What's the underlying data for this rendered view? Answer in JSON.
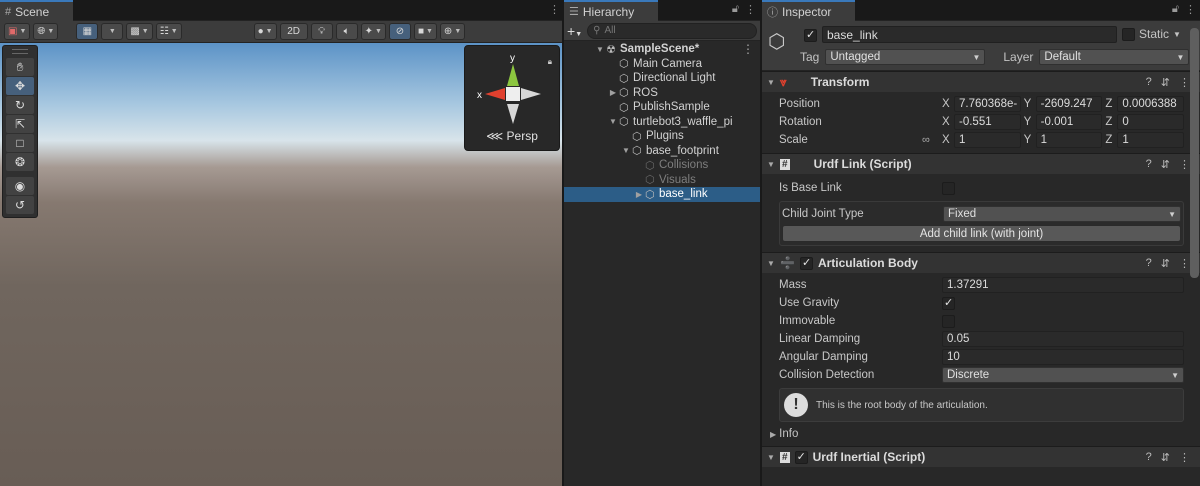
{
  "scene": {
    "tab_label": "Scene",
    "mode_2d": "2D",
    "persp_label": "Persp",
    "gizmo_y": "y",
    "gizmo_x": "x"
  },
  "hierarchy": {
    "tab_label": "Hierarchy",
    "search_placeholder": "All",
    "items": [
      {
        "label": "SampleScene*",
        "depth": 0,
        "expanded": true,
        "type": "scene"
      },
      {
        "label": "Main Camera",
        "depth": 1
      },
      {
        "label": "Directional Light",
        "depth": 1
      },
      {
        "label": "ROS",
        "depth": 1,
        "collapsed": true
      },
      {
        "label": "PublishSample",
        "depth": 1
      },
      {
        "label": "turtlebot3_waffle_pi",
        "depth": 1,
        "expanded": true
      },
      {
        "label": "Plugins",
        "depth": 2
      },
      {
        "label": "base_footprint",
        "depth": 2,
        "expanded": true
      },
      {
        "label": "Collisions",
        "depth": 3,
        "dim": true
      },
      {
        "label": "Visuals",
        "depth": 3,
        "dim": true
      },
      {
        "label": "base_link",
        "depth": 3,
        "collapsed": true,
        "selected": true
      }
    ]
  },
  "inspector": {
    "tab_label": "Inspector",
    "object_name": "base_link",
    "static_label": "Static",
    "tag_label": "Tag",
    "tag_value": "Untagged",
    "layer_label": "Layer",
    "layer_value": "Default",
    "transform": {
      "title": "Transform",
      "position_label": "Position",
      "rotation_label": "Rotation",
      "scale_label": "Scale",
      "position": {
        "x": "7.760368e-",
        "y": "-2609.247",
        "z": "0.0006388"
      },
      "rotation": {
        "x": "-0.551",
        "y": "-0.001",
        "z": "0"
      },
      "scale": {
        "x": "1",
        "y": "1",
        "z": "1"
      }
    },
    "urdf_link": {
      "title": "Urdf Link (Script)",
      "is_base_label": "Is Base Link",
      "child_joint_label": "Child Joint Type",
      "child_joint_value": "Fixed",
      "add_child_button": "Add child link (with joint)"
    },
    "articulation": {
      "title": "Articulation Body",
      "mass_label": "Mass",
      "mass": "1.37291",
      "use_gravity_label": "Use Gravity",
      "immovable_label": "Immovable",
      "linear_damping_label": "Linear Damping",
      "linear_damping": "0.05",
      "angular_damping_label": "Angular Damping",
      "angular_damping": "10",
      "collision_label": "Collision Detection",
      "collision_value": "Discrete",
      "help_text": "This is the root body of the articulation.",
      "info_label": "Info"
    },
    "urdf_inertial": {
      "title": "Urdf Inertial (Script)"
    }
  },
  "axis_labels": {
    "x": "X",
    "y": "Y",
    "z": "Z"
  },
  "colors": {
    "selection": "#2c5d87",
    "tab_accent": "#3a79bb",
    "gizmo_y": "#8cc63f",
    "gizmo_x": "#e0402e"
  }
}
